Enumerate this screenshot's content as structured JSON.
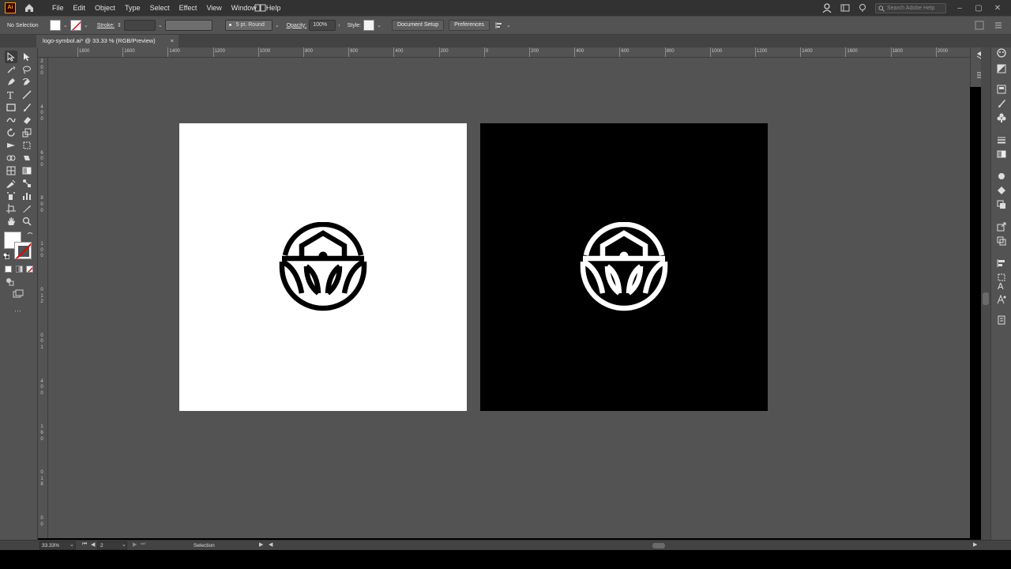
{
  "app": {
    "logo_text": "Ai"
  },
  "menu": {
    "items": [
      "File",
      "Edit",
      "Object",
      "Type",
      "Select",
      "Effect",
      "View",
      "Window",
      "Help"
    ],
    "search_placeholder": "Search Adobe Help"
  },
  "control_bar": {
    "selection_status": "No Selection",
    "stroke_label": "Stroke:",
    "brush_value": "5 pt. Round",
    "opacity_label": "Opacity:",
    "opacity_value": "100%",
    "style_label": "Style:",
    "document_setup_label": "Document Setup",
    "preferences_label": "Preferences"
  },
  "document_tab": {
    "title": "logo-symbol.ai* @ 33.33 % (RGB/Preview)",
    "close": "×"
  },
  "ruler_top": [
    "1800",
    "1600",
    "1400",
    "1200",
    "1000",
    "800",
    "600",
    "400",
    "200",
    "0",
    "200",
    "400",
    "600",
    "800",
    "1000",
    "1200",
    "1400",
    "1600",
    "1800",
    "2000"
  ],
  "ruler_left": [
    "2",
    "0",
    "0",
    "4",
    "0",
    "0",
    "6",
    "0",
    "0",
    "8",
    "0",
    "0",
    "1",
    "0",
    "0",
    "0",
    "1",
    "2",
    "0",
    "0",
    "1",
    "4",
    "0",
    "0",
    "1",
    "6",
    "0",
    "0",
    "1",
    "8",
    "0",
    "0"
  ],
  "artboards": [
    {
      "background": "#ffffff",
      "logo_color": "#000000"
    },
    {
      "background": "#000000",
      "logo_color": "#ffffff"
    }
  ],
  "status_bar": {
    "zoom": "33.33%",
    "page": "2",
    "tool_status": "Selection"
  },
  "colors": {
    "ui_dark": "#323232",
    "ui_mid": "#535353",
    "accent_orange": "#ff9a00"
  }
}
